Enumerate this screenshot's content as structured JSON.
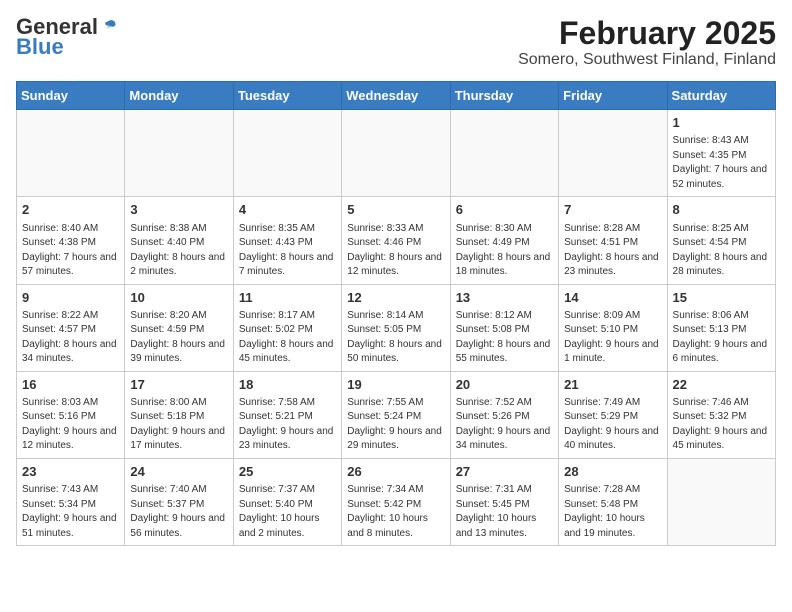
{
  "header": {
    "logo": {
      "general": "General",
      "blue": "Blue"
    },
    "title": "February 2025",
    "subtitle": "Somero, Southwest Finland, Finland"
  },
  "weekdays": [
    "Sunday",
    "Monday",
    "Tuesday",
    "Wednesday",
    "Thursday",
    "Friday",
    "Saturday"
  ],
  "weeks": [
    [
      {
        "day": "",
        "info": ""
      },
      {
        "day": "",
        "info": ""
      },
      {
        "day": "",
        "info": ""
      },
      {
        "day": "",
        "info": ""
      },
      {
        "day": "",
        "info": ""
      },
      {
        "day": "",
        "info": ""
      },
      {
        "day": "1",
        "info": "Sunrise: 8:43 AM\nSunset: 4:35 PM\nDaylight: 7 hours and 52 minutes."
      }
    ],
    [
      {
        "day": "2",
        "info": "Sunrise: 8:40 AM\nSunset: 4:38 PM\nDaylight: 7 hours and 57 minutes."
      },
      {
        "day": "3",
        "info": "Sunrise: 8:38 AM\nSunset: 4:40 PM\nDaylight: 8 hours and 2 minutes."
      },
      {
        "day": "4",
        "info": "Sunrise: 8:35 AM\nSunset: 4:43 PM\nDaylight: 8 hours and 7 minutes."
      },
      {
        "day": "5",
        "info": "Sunrise: 8:33 AM\nSunset: 4:46 PM\nDaylight: 8 hours and 12 minutes."
      },
      {
        "day": "6",
        "info": "Sunrise: 8:30 AM\nSunset: 4:49 PM\nDaylight: 8 hours and 18 minutes."
      },
      {
        "day": "7",
        "info": "Sunrise: 8:28 AM\nSunset: 4:51 PM\nDaylight: 8 hours and 23 minutes."
      },
      {
        "day": "8",
        "info": "Sunrise: 8:25 AM\nSunset: 4:54 PM\nDaylight: 8 hours and 28 minutes."
      }
    ],
    [
      {
        "day": "9",
        "info": "Sunrise: 8:22 AM\nSunset: 4:57 PM\nDaylight: 8 hours and 34 minutes."
      },
      {
        "day": "10",
        "info": "Sunrise: 8:20 AM\nSunset: 4:59 PM\nDaylight: 8 hours and 39 minutes."
      },
      {
        "day": "11",
        "info": "Sunrise: 8:17 AM\nSunset: 5:02 PM\nDaylight: 8 hours and 45 minutes."
      },
      {
        "day": "12",
        "info": "Sunrise: 8:14 AM\nSunset: 5:05 PM\nDaylight: 8 hours and 50 minutes."
      },
      {
        "day": "13",
        "info": "Sunrise: 8:12 AM\nSunset: 5:08 PM\nDaylight: 8 hours and 55 minutes."
      },
      {
        "day": "14",
        "info": "Sunrise: 8:09 AM\nSunset: 5:10 PM\nDaylight: 9 hours and 1 minute."
      },
      {
        "day": "15",
        "info": "Sunrise: 8:06 AM\nSunset: 5:13 PM\nDaylight: 9 hours and 6 minutes."
      }
    ],
    [
      {
        "day": "16",
        "info": "Sunrise: 8:03 AM\nSunset: 5:16 PM\nDaylight: 9 hours and 12 minutes."
      },
      {
        "day": "17",
        "info": "Sunrise: 8:00 AM\nSunset: 5:18 PM\nDaylight: 9 hours and 17 minutes."
      },
      {
        "day": "18",
        "info": "Sunrise: 7:58 AM\nSunset: 5:21 PM\nDaylight: 9 hours and 23 minutes."
      },
      {
        "day": "19",
        "info": "Sunrise: 7:55 AM\nSunset: 5:24 PM\nDaylight: 9 hours and 29 minutes."
      },
      {
        "day": "20",
        "info": "Sunrise: 7:52 AM\nSunset: 5:26 PM\nDaylight: 9 hours and 34 minutes."
      },
      {
        "day": "21",
        "info": "Sunrise: 7:49 AM\nSunset: 5:29 PM\nDaylight: 9 hours and 40 minutes."
      },
      {
        "day": "22",
        "info": "Sunrise: 7:46 AM\nSunset: 5:32 PM\nDaylight: 9 hours and 45 minutes."
      }
    ],
    [
      {
        "day": "23",
        "info": "Sunrise: 7:43 AM\nSunset: 5:34 PM\nDaylight: 9 hours and 51 minutes."
      },
      {
        "day": "24",
        "info": "Sunrise: 7:40 AM\nSunset: 5:37 PM\nDaylight: 9 hours and 56 minutes."
      },
      {
        "day": "25",
        "info": "Sunrise: 7:37 AM\nSunset: 5:40 PM\nDaylight: 10 hours and 2 minutes."
      },
      {
        "day": "26",
        "info": "Sunrise: 7:34 AM\nSunset: 5:42 PM\nDaylight: 10 hours and 8 minutes."
      },
      {
        "day": "27",
        "info": "Sunrise: 7:31 AM\nSunset: 5:45 PM\nDaylight: 10 hours and 13 minutes."
      },
      {
        "day": "28",
        "info": "Sunrise: 7:28 AM\nSunset: 5:48 PM\nDaylight: 10 hours and 19 minutes."
      },
      {
        "day": "",
        "info": ""
      }
    ]
  ]
}
